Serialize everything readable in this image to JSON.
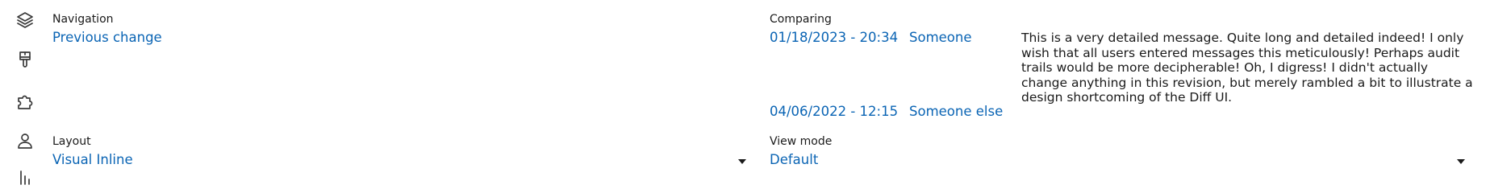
{
  "sidebar": {
    "icons": [
      "layers-icon",
      "brush-icon",
      "puzzle-icon",
      "user-icon",
      "chart-icon"
    ]
  },
  "navigation": {
    "heading": "Navigation",
    "previous_change": "Previous change"
  },
  "comparing": {
    "heading": "Comparing",
    "revisions": [
      {
        "date": "01/18/2023 - 20:34",
        "author": "Someone",
        "message": "This is a very detailed message. Quite long and detailed indeed! I only wish that all users entered messages this meticulously! Perhaps audit trails would be more decipherable! Oh, I digress! I didn't actually change anything in this revision, but merely rambled a bit to illustrate a design shortcoming of the Diff UI."
      },
      {
        "date": "04/06/2022 - 12:15",
        "author": "Someone else",
        "message": ""
      }
    ]
  },
  "layout": {
    "heading": "Layout",
    "selected": "Visual Inline"
  },
  "view_mode": {
    "heading": "View mode",
    "selected": "Default"
  },
  "colors": {
    "link": "#0a64b4",
    "text": "#1a1a1a",
    "icon": "#3a3a3a"
  }
}
